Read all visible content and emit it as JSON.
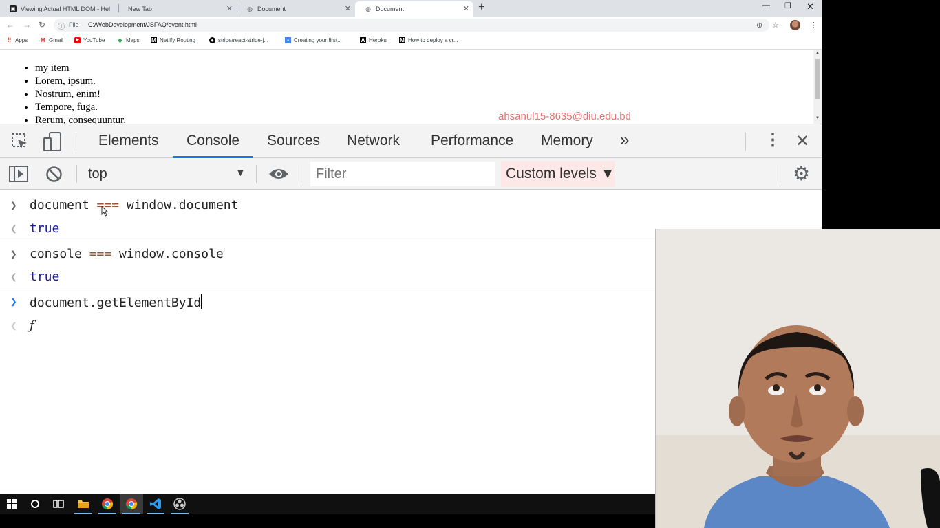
{
  "browser": {
    "tabs": [
      {
        "title": "Viewing Actual HTML DOM - Hel",
        "icon": "app-icon"
      },
      {
        "title": "New Tab",
        "icon": "none"
      },
      {
        "title": "Document",
        "icon": "globe-icon"
      },
      {
        "title": "Document",
        "icon": "globe-icon",
        "active": true
      }
    ],
    "omnibox": {
      "scheme_label": "File",
      "url": "C:/WebDevelopment/JSFAQ/event.html"
    },
    "bookmarks": [
      {
        "label": "Apps",
        "icon": "apps-grid-icon",
        "color": "#e8453c"
      },
      {
        "label": "Gmail",
        "icon": "gmail-icon",
        "color": "#d93025"
      },
      {
        "label": "YouTube",
        "icon": "youtube-icon",
        "color": "#ff0000"
      },
      {
        "label": "Maps",
        "icon": "maps-icon",
        "color": "#34a853"
      },
      {
        "label": "Netlify Routing",
        "icon": "medium-icon",
        "color": "#000000"
      },
      {
        "label": "stripe/react-stripe-j...",
        "icon": "github-icon",
        "color": "#000000"
      },
      {
        "label": "Creating your first...",
        "icon": "bookmark-page-icon",
        "color": "#4285f4"
      },
      {
        "label": "Heroku",
        "icon": "heroku-icon",
        "color": "#000000"
      },
      {
        "label": "How to deploy a cr...",
        "icon": "medium-icon",
        "color": "#000000"
      }
    ]
  },
  "page": {
    "list_items": [
      "my item",
      "Lorem, ipsum.",
      "Nostrum, enim!",
      "Tempore, fuga.",
      "Rerum, consequuntur."
    ],
    "watermark": "ahsanul15-8635@diu.edu.bd"
  },
  "devtools": {
    "tabs": [
      "Elements",
      "Console",
      "Sources",
      "Network",
      "Performance",
      "Memory"
    ],
    "active_tab": "Console",
    "more_tabs_icon": "»",
    "context": "top",
    "filter_placeholder": "Filter",
    "levels_label": "Custom levels ▼",
    "accent_color": "#1a73e8"
  },
  "console": {
    "entries": [
      {
        "input_left": "document ",
        "op": "===",
        "input_right": " window.document",
        "result": "true"
      },
      {
        "input_left": "console ",
        "op": "===",
        "input_right": " window.console",
        "result": "true"
      }
    ],
    "current_input": "document.getElementById",
    "preview": "ƒ"
  },
  "taskbar": {
    "items": [
      "windows-start-icon",
      "cortana-search-icon",
      "task-view-icon",
      "file-explorer-icon",
      "chrome-icon",
      "chrome-icon",
      "vscode-icon",
      "obs-icon"
    ]
  }
}
